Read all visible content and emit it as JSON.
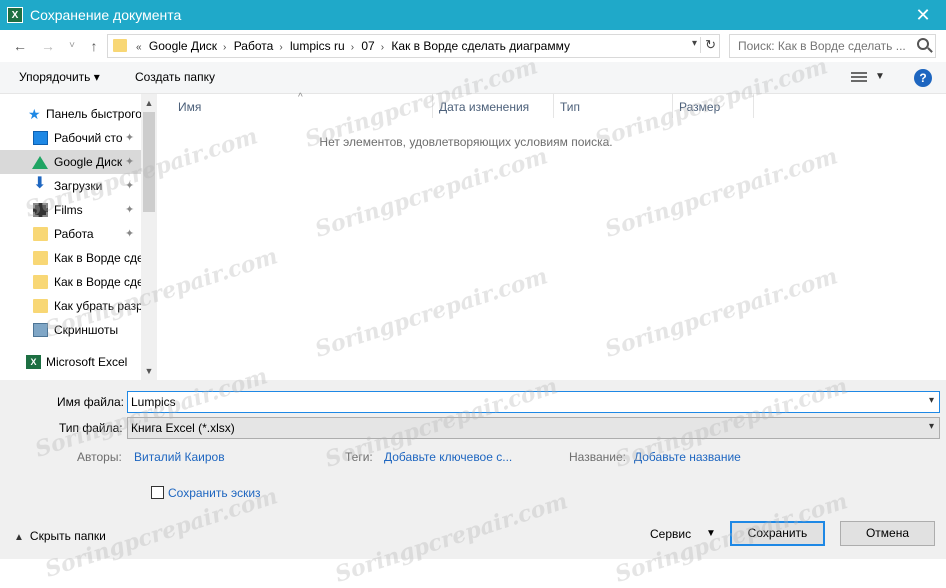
{
  "window": {
    "title": "Сохранение документа",
    "close_glyph": "✕"
  },
  "nav": {
    "back": "←",
    "forward": "→",
    "recent": "˅",
    "up": "↑"
  },
  "address": {
    "prefix": "«",
    "crumbs": [
      "Google Диск",
      "Работа",
      "lumpics ru",
      "07",
      "Как в Ворде сделать диаграмму"
    ],
    "separator": "›"
  },
  "search": {
    "placeholder": "Поиск: Как в Ворде сделать ..."
  },
  "toolbar": {
    "organize": "Упорядочить ▾",
    "new_folder": "Создать папку",
    "help": "?"
  },
  "sidebar": {
    "items": [
      {
        "label": "Панель быстрого",
        "icon": "star-icon"
      },
      {
        "label": "Рабочий сто",
        "icon": "desktop-icon",
        "pinned": true
      },
      {
        "label": "Google Диск",
        "icon": "google-drive-icon",
        "pinned": true,
        "selected": true
      },
      {
        "label": "Загрузки",
        "icon": "download-icon",
        "pinned": true
      },
      {
        "label": "Films",
        "icon": "film-icon",
        "pinned": true
      },
      {
        "label": "Работа",
        "icon": "folder-icon",
        "pinned": true
      },
      {
        "label": "Как в Ворде сде",
        "icon": "folder-icon"
      },
      {
        "label": "Как в Ворде сде",
        "icon": "folder-icon"
      },
      {
        "label": "Как убрать разр",
        "icon": "folder-icon"
      },
      {
        "label": "Скриншоты",
        "icon": "pictures-folder-icon"
      },
      {
        "label": "Microsoft Excel",
        "icon": "excel-icon"
      }
    ],
    "pin_glyph": "📌"
  },
  "file_list": {
    "columns": [
      "Имя",
      "Дата изменения",
      "Тип",
      "Размер"
    ],
    "empty_message": "Нет элементов, удовлетворяющих условиям поиска."
  },
  "form": {
    "filename_label": "Имя файла:",
    "filename_value": "Lumpics",
    "filetype_label": "Тип файла:",
    "filetype_value": "Книга Excel (*.xlsx)",
    "authors_label": "Авторы:",
    "authors_value": "Виталий Каиров",
    "tags_label": "Теги:",
    "tags_value": "Добавьте ключевое с...",
    "title_label": "Название:",
    "title_value": "Добавьте название",
    "thumbnail_label": "Сохранить эскиз"
  },
  "footer": {
    "hide_folders": "Скрыть папки",
    "service": "Сервис",
    "save": "Сохранить",
    "cancel": "Отмена"
  },
  "watermark": "Soringpcrepair.com"
}
